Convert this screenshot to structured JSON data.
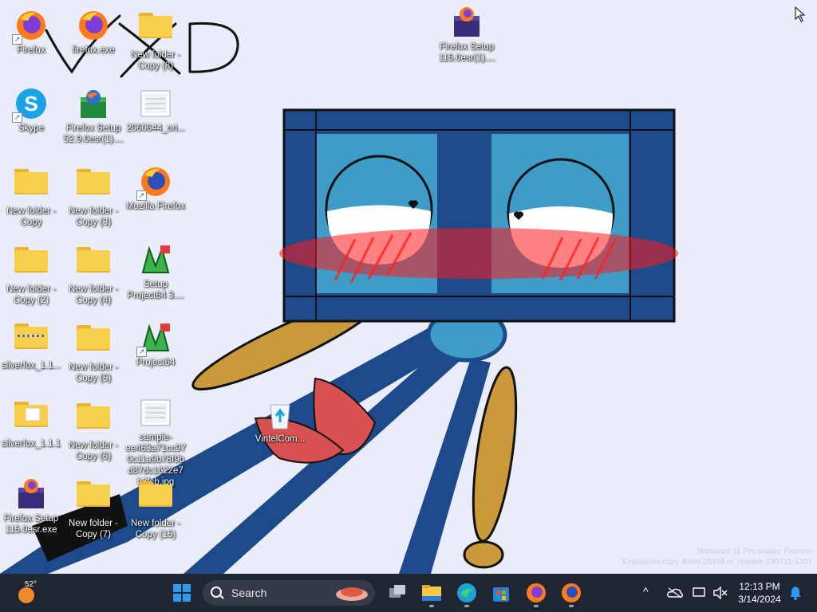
{
  "desktop": {
    "icons": [
      {
        "label": "Firefox",
        "type": "firefox",
        "shortcut": true
      },
      {
        "label": "firefox.exe",
        "type": "firefox",
        "shortcut": false
      },
      {
        "label": "New folder - Copy (8)",
        "type": "folder",
        "shortcut": false
      },
      {
        "label": "Firefox Setup 115.0esr(1)....",
        "type": "setup-box",
        "shortcut": false
      },
      {
        "label": "Skype",
        "type": "skype",
        "shortcut": true
      },
      {
        "label": "Firefox Setup 52.9.0esr(1)....",
        "type": "setup-green",
        "shortcut": false
      },
      {
        "label": "2060644_ori...",
        "type": "image-file",
        "shortcut": false
      },
      {
        "label": "New folder - Copy",
        "type": "folder",
        "shortcut": false
      },
      {
        "label": "New folder - Copy (3)",
        "type": "folder",
        "shortcut": false
      },
      {
        "label": "Mozilla Firefox",
        "type": "firefox-blue",
        "shortcut": true
      },
      {
        "label": "New folder - Copy (2)",
        "type": "folder",
        "shortcut": false
      },
      {
        "label": "New folder - Copy (4)",
        "type": "folder",
        "shortcut": false
      },
      {
        "label": "Setup Project64 3....",
        "type": "project64",
        "shortcut": false
      },
      {
        "label": "silverfox_1.1...",
        "type": "zip-folder",
        "shortcut": false
      },
      {
        "label": "New folder - Copy (5)",
        "type": "folder",
        "shortcut": false
      },
      {
        "label": "Project64",
        "type": "project64",
        "shortcut": true
      },
      {
        "label": "silverfox_1.1.1",
        "type": "folder-open",
        "shortcut": false
      },
      {
        "label": "New folder - Copy (6)",
        "type": "folder",
        "shortcut": false
      },
      {
        "label": "sample-ee463a71cc970c11a9b78f9bd87dc1622e7b3fcb.jpg",
        "type": "image-file",
        "shortcut": false
      },
      {
        "label": "VintelCom...",
        "type": "recycle",
        "shortcut": false
      },
      {
        "label": "Firefox Setup 115.0esr.exe",
        "type": "setup-box",
        "shortcut": false
      },
      {
        "label": "New folder - Copy (7)",
        "type": "folder",
        "shortcut": false
      },
      {
        "label": "New folder - Copy (15)",
        "type": "folder",
        "shortcut": false
      }
    ],
    "watermark_line1": "Windows 11 Pro Insider Preview",
    "watermark_line2": "Evaluation copy. Build 25398.ni_release.230711-1301"
  },
  "taskbar": {
    "weather_temp": "52°",
    "search_placeholder": "Search",
    "pinned": [
      "start-icon",
      "search",
      "task-view-icon",
      "file-explorer-icon",
      "edge-icon",
      "store-icon",
      "firefox-icon",
      "firefox-icon"
    ],
    "time": "12:13 PM",
    "date": "3/14/2024"
  },
  "colors": {
    "taskbar": "#1f2533",
    "wallpaper_bg": "#e9ecf8",
    "window_frame": "#1d4a8a",
    "window_glass": "#3e9cc7",
    "accent_red": "#ff1a1a",
    "limb_gold": "#c9993a"
  }
}
